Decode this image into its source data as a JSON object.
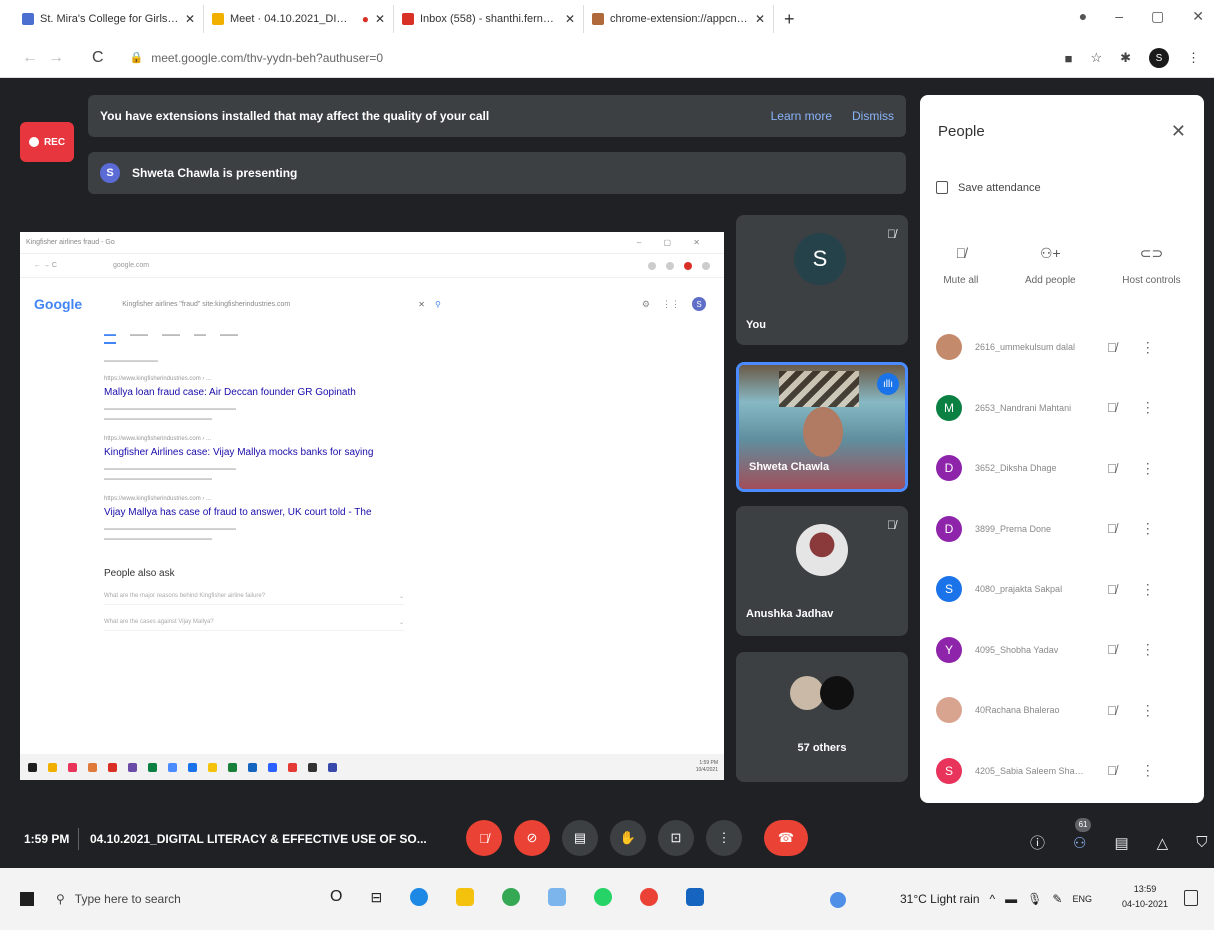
{
  "browser": {
    "tabs": [
      {
        "label": "St. Mira's College for Girls | Cal",
        "color": "#4a6fd1"
      },
      {
        "label": "Meet · 04.10.2021_DIGITA",
        "color": "#f1b000"
      },
      {
        "label": "Inbox (558) - shanthi.fernandes",
        "color": "#d93025"
      },
      {
        "label": "chrome-extension://appcnhief",
        "color": "#b0693b"
      }
    ],
    "new_tab": "+",
    "url": "meet.google.com/thv-yydn-beh?authuser=0"
  },
  "meet": {
    "rec_label": "REC",
    "extension_banner": {
      "message": "You have extensions installed that may affect the quality of your call",
      "learn_more": "Learn more",
      "dismiss": "Dismiss"
    },
    "presenting": {
      "initial": "S",
      "text": "Shweta Chawla is presenting"
    },
    "shared_screen": {
      "tab_title": "Kingfisher airlines fraud - Go",
      "domain": "google.com",
      "logo": "Google",
      "query": "Kingfisher airlines \"fraud\" site:kingfisherindustries.com",
      "user_initial": "S",
      "results": [
        {
          "cite": "https://www.kingfisherindustries.com › ...",
          "title": "Mallya loan fraud case: Air Deccan founder GR Gopinath"
        },
        {
          "cite": "https://www.kingfisherindustries.com › ...",
          "title": "Kingfisher Airlines case: Vijay Mallya mocks banks for saying"
        },
        {
          "cite": "https://www.kingfisherindustries.com › ...",
          "title": "Vijay Mallya has case of fraud to answer, UK court told - The"
        }
      ],
      "people_also_ask": "People also ask",
      "paa_questions": [
        "What are the major reasons behind Kingfisher airline failure?",
        "What are the cases against Vijay Mallya?"
      ],
      "clock_time": "1:59 PM",
      "clock_date": "10/4/2021"
    },
    "tiles": {
      "you": {
        "initial": "S",
        "name": "You"
      },
      "shweta": {
        "name": "Shweta Chawla"
      },
      "anushka": {
        "name": "Anushka Jadhav"
      },
      "others": {
        "name": "57 others"
      }
    },
    "people_panel": {
      "title": "People",
      "save_attendance": "Save attendance",
      "actions": [
        {
          "label": "Mute all",
          "icon": "mic-off-icon"
        },
        {
          "label": "Add people",
          "icon": "add-person-icon"
        },
        {
          "label": "Host controls",
          "icon": "host-controls-icon"
        }
      ],
      "participants": [
        {
          "initial": "",
          "name": "2616_ummekulsum dalal",
          "color": "#c48a6c"
        },
        {
          "initial": "M",
          "name": "2653_Nandrani Mahtani",
          "color": "#0b8043"
        },
        {
          "initial": "D",
          "name": "3652_Diksha Dhage",
          "color": "#8e24aa"
        },
        {
          "initial": "D",
          "name": "3899_Prerna Done",
          "color": "#8e24aa"
        },
        {
          "initial": "S",
          "name": "4080_prajakta Sakpal",
          "color": "#1a73e8"
        },
        {
          "initial": "Y",
          "name": "4095_Shobha Yadav",
          "color": "#8e24aa"
        },
        {
          "initial": "",
          "name": "40Rachana Bhalerao",
          "color": "#d8a48f"
        },
        {
          "initial": "S",
          "name": "4205_Sabia Saleem Shaikh",
          "color": "#e8335a"
        }
      ]
    },
    "bottom_bar": {
      "time": "1:59 PM",
      "meeting_title": "04.10.2021_DIGITAL LITERACY & EFFECTIVE USE OF SO...",
      "participant_count": "61"
    }
  },
  "taskbar": {
    "search_placeholder": "Type here to search",
    "weather": "31°C  Light rain",
    "language": "ENG",
    "time": "13:59",
    "date": "04-10-2021"
  }
}
